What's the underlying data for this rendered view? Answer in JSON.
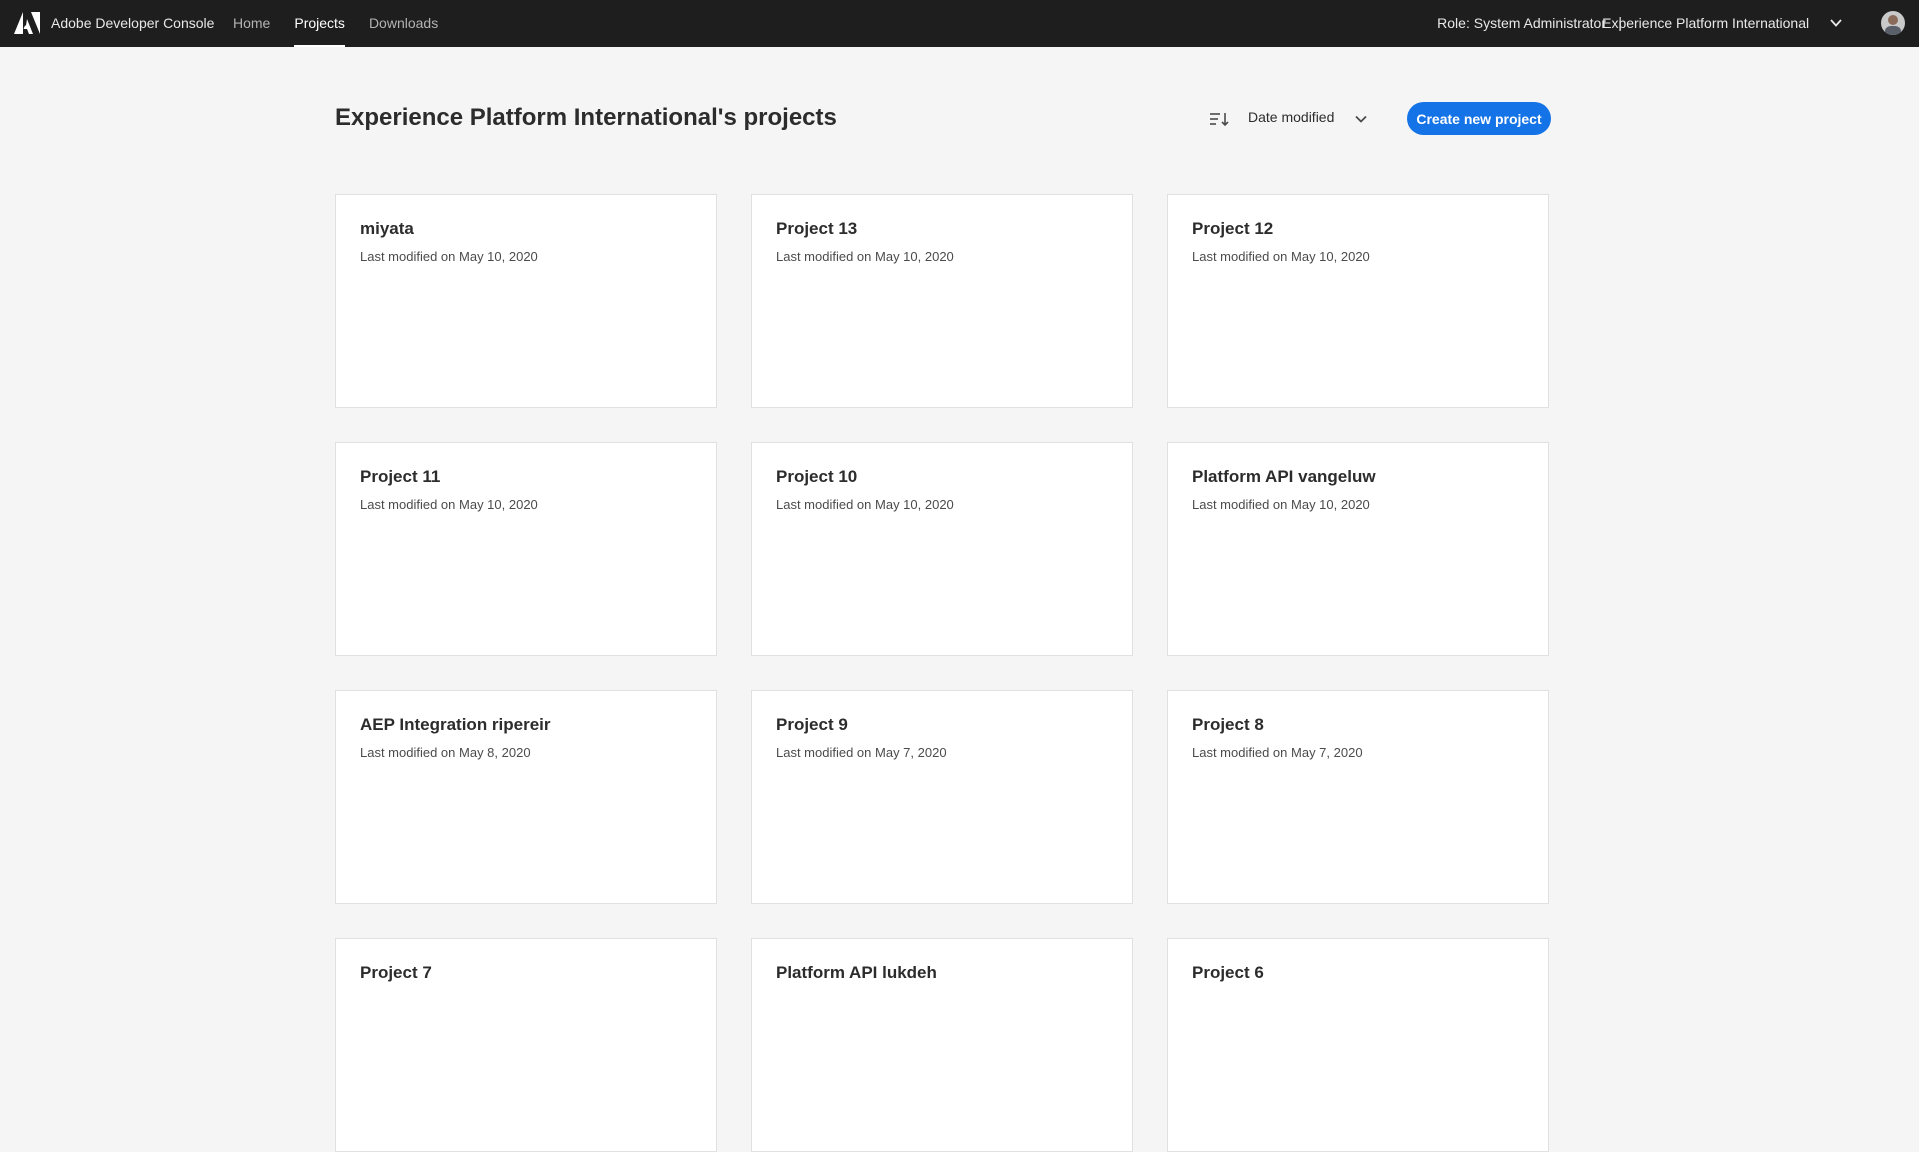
{
  "topbar": {
    "app_title": "Adobe Developer Console",
    "nav": [
      "Home",
      "Projects",
      "Downloads"
    ],
    "active_nav": "Projects",
    "role": "Role: System Administrator",
    "separator": "|",
    "org": "Experience Platform International"
  },
  "header": {
    "title": "Experience Platform International's projects",
    "sort_label": "Date modified",
    "create_label": "Create new project"
  },
  "projects": [
    {
      "name": "miyata",
      "modified": "Last modified on May 10, 2020"
    },
    {
      "name": "Project 13",
      "modified": "Last modified on May 10, 2020"
    },
    {
      "name": "Project 12",
      "modified": "Last modified on May 10, 2020"
    },
    {
      "name": "Project 11",
      "modified": "Last modified on May 10, 2020"
    },
    {
      "name": "Project 10",
      "modified": "Last modified on May 10, 2020"
    },
    {
      "name": "Platform API vangeluw",
      "modified": "Last modified on May 10, 2020"
    },
    {
      "name": "AEP Integration ripereir",
      "modified": "Last modified on May 8, 2020"
    },
    {
      "name": "Project 9",
      "modified": "Last modified on May 7, 2020"
    },
    {
      "name": "Project 8",
      "modified": "Last modified on May 7, 2020"
    },
    {
      "name": "Project 7",
      "modified": ""
    },
    {
      "name": "Platform API lukdeh",
      "modified": ""
    },
    {
      "name": "Project 6",
      "modified": ""
    }
  ],
  "colors": {
    "topbar": "#1e1e1e",
    "accent": "#1473e6",
    "background": "#f5f5f5"
  }
}
